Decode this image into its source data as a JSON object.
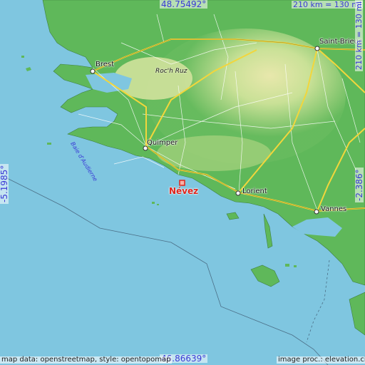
{
  "map": {
    "coords": {
      "north": "48.75492°",
      "south": "46.86639°",
      "west": "-5.1985°",
      "east": "-2.386°"
    },
    "scale": {
      "horizontal": "210 km = 130 mi",
      "vertical": "210 km = 130 mi"
    },
    "marker": {
      "label": "Névez"
    },
    "places": {
      "brest": "Brest",
      "quimper": "Quimper",
      "lorient": "Lorient",
      "vannes": "Vannes",
      "saint_brieuc": "Saint-Brieuc",
      "roc_h_ruz": "Roc'h Ruz",
      "baie": "Baie d'Audierne"
    },
    "credits": {
      "left": "map data: openstreetmap, style: opentopomap",
      "right": "image proc.: elevation.city"
    },
    "colors": {
      "sea": "#7fc6e0",
      "lowland": "#5fb85a",
      "upland": "#e8e7a6",
      "motorway": "#f2d63c",
      "marker": "#e0241b",
      "coord_text": "#3b3bd6"
    }
  }
}
